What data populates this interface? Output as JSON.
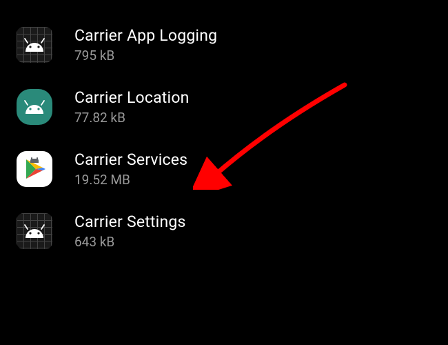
{
  "apps": [
    {
      "name": "Carrier App Logging",
      "size": "795 kB",
      "icon": "grid-android"
    },
    {
      "name": "Carrier Location",
      "size": "77.82 kB",
      "icon": "teal-android"
    },
    {
      "name": "Carrier Services",
      "size": "19.52 MB",
      "icon": "play-services"
    },
    {
      "name": "Carrier Settings",
      "size": "643 kB",
      "icon": "grid-android"
    }
  ],
  "annotation": {
    "arrow_color": "#ff0000"
  }
}
